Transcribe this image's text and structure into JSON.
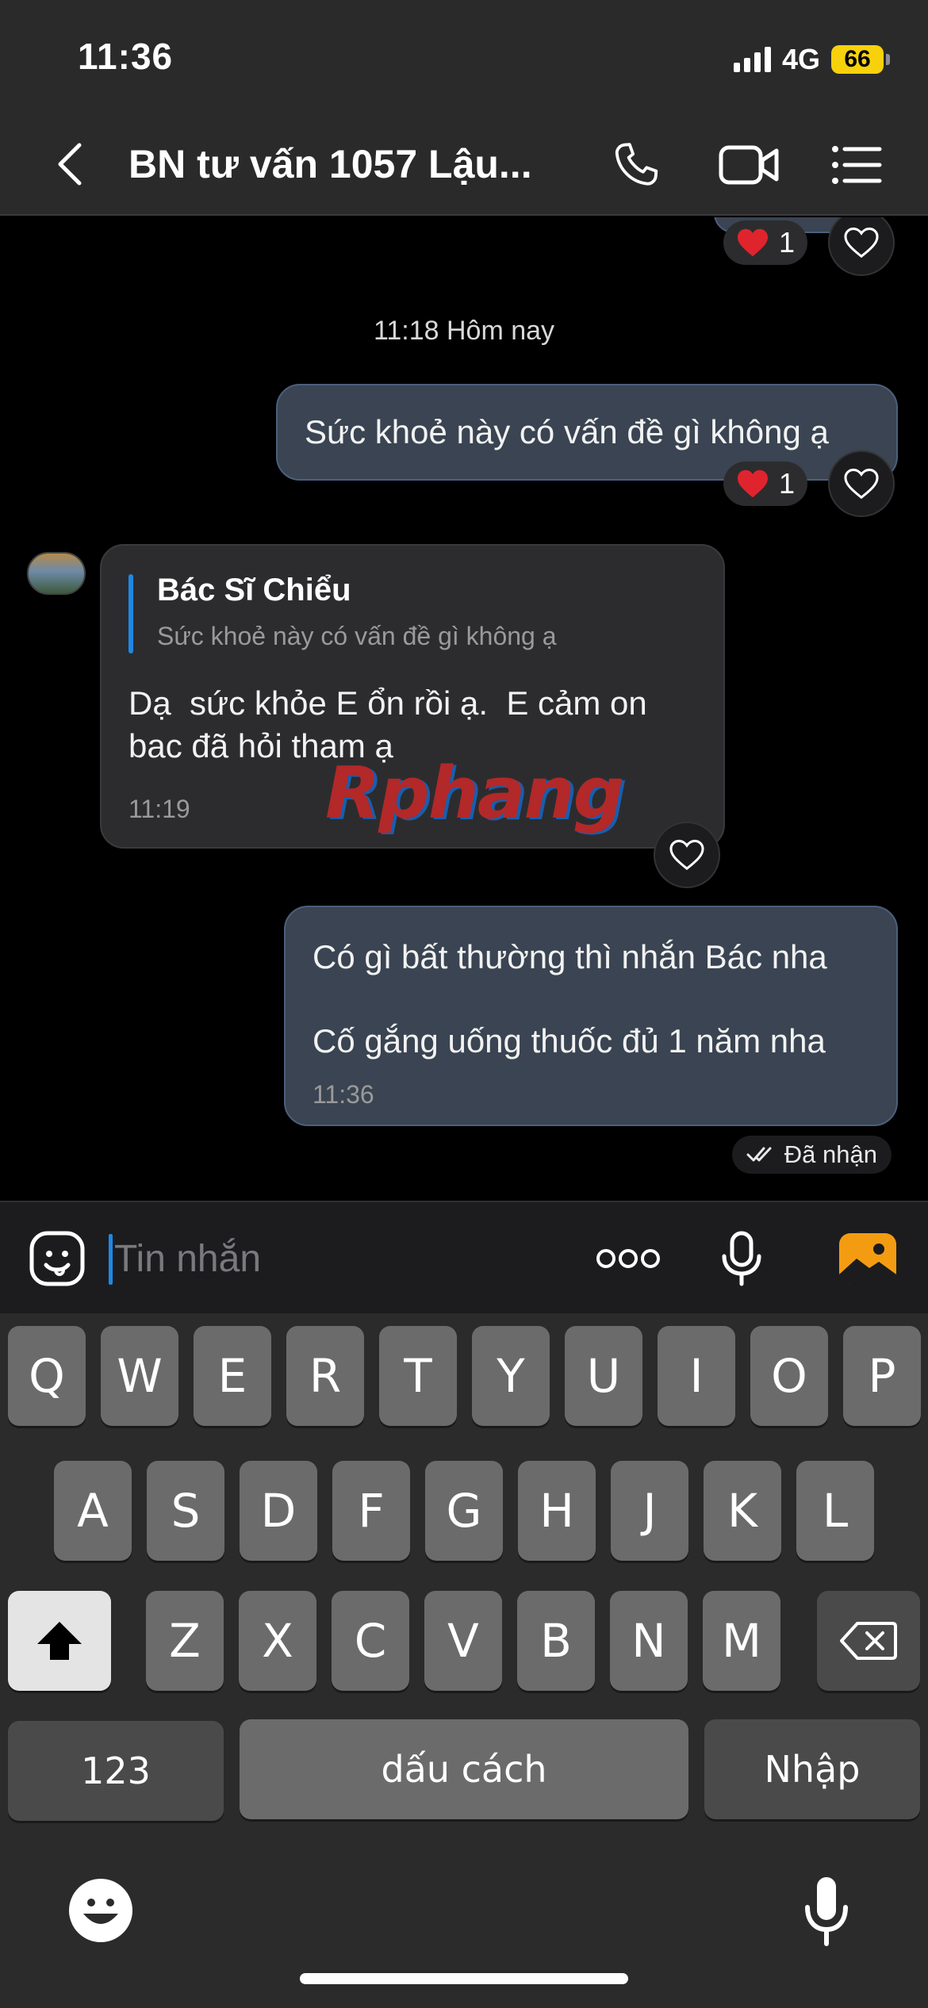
{
  "status_bar": {
    "time": "11:36",
    "network": "4G",
    "battery": "66",
    "battery_color": "#f7d10b"
  },
  "header": {
    "title": "BN tư vấn 1057 Lậu..."
  },
  "chat": {
    "top_reaction_count": "1",
    "separator_time": "11:18 Hôm nay",
    "outgoing_1": {
      "text": "Sức khoẻ này có vấn đề gì không ạ",
      "reaction_count": "1"
    },
    "incoming_1": {
      "quote_sender": "Bác Sĩ Chiểu",
      "quote_text": "Sức khoẻ này có vấn đề gì không ạ",
      "line1": "Dạ  sức khỏe E ổn rồi ạ.  E cảm on",
      "line2": "bac đã hỏi tham ạ",
      "time": "11:19"
    },
    "outgoing_2": {
      "line1": "Có gì bất thường thì nhắn Bác nha",
      "line2": "Cố gắng uống thuốc đủ 1 năm nha",
      "time": "11:36"
    },
    "delivery_status": "Đã nhận",
    "watermark": "Rphang"
  },
  "input": {
    "placeholder": "Tin nhắn",
    "more_label": "ooo"
  },
  "keyboard": {
    "row1": [
      "Q",
      "W",
      "E",
      "R",
      "T",
      "Y",
      "U",
      "I",
      "O",
      "P"
    ],
    "row2": [
      "A",
      "S",
      "D",
      "F",
      "G",
      "H",
      "J",
      "K",
      "L"
    ],
    "row3": [
      "Z",
      "X",
      "C",
      "V",
      "B",
      "N",
      "M"
    ],
    "numbers_label": "123",
    "space_label": "dấu cách",
    "return_label": "Nhập"
  },
  "colors": {
    "accent": "#1e88e5",
    "outgoing_bubble": "#3a4452",
    "incoming_bubble": "#2c2c2e",
    "reaction_heart": "#e0242d"
  }
}
